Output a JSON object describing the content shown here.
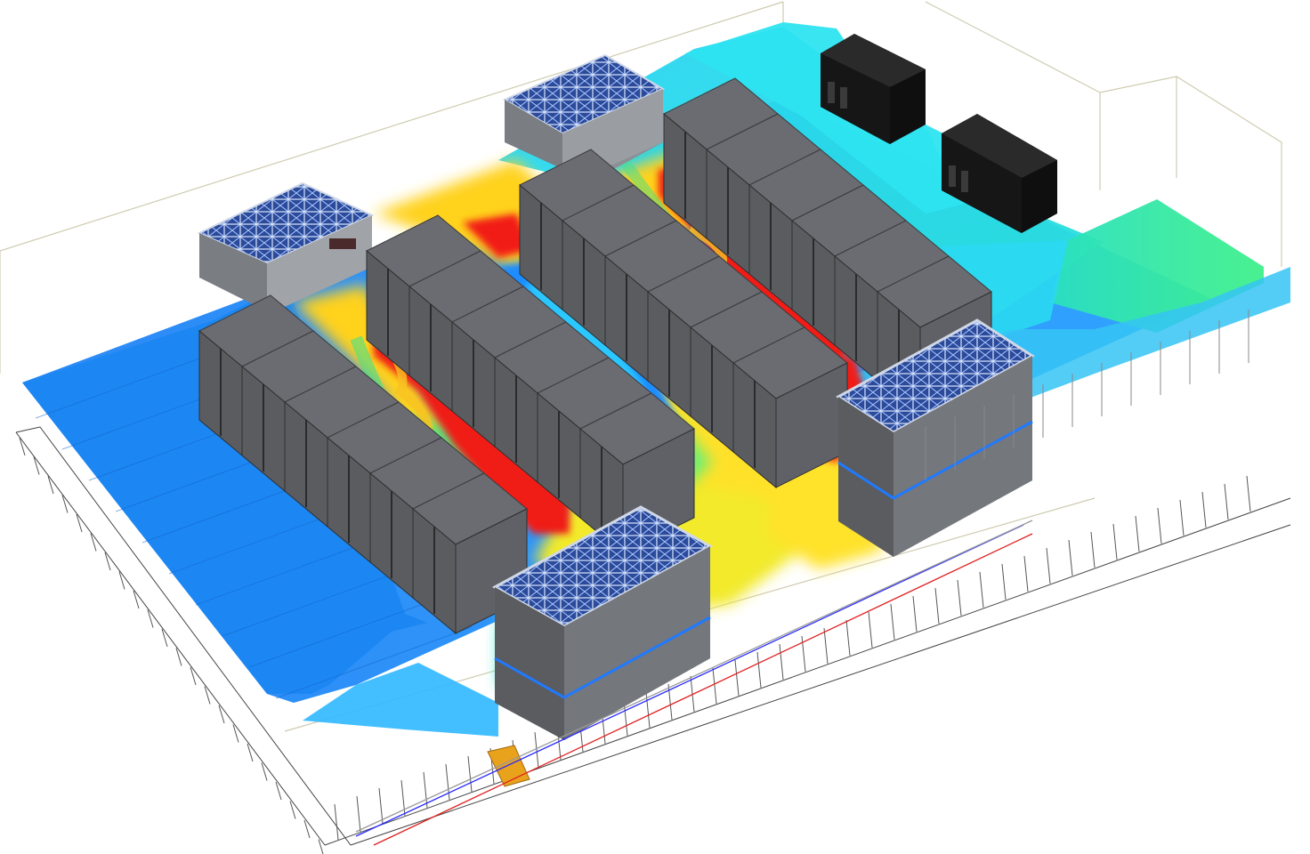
{
  "viewport": {
    "background": "#ffffff",
    "wire_color": "#c9c6a8",
    "floor_grid_color": "#3a3a3a"
  },
  "heatmap": {
    "scale": [
      "#1e88ff",
      "#22b8ff",
      "#23e0f0",
      "#3be8a8",
      "#8ef04a",
      "#e8f02a",
      "#ffc21a",
      "#ff7a1a",
      "#f02018"
    ],
    "cold_color": "#1e88ff",
    "cool_color": "#23d8f8",
    "hot_color": "#f02018",
    "warm_color": "#ffe21a"
  },
  "objects": {
    "rack_rows": [
      {
        "name": "rack-row-1",
        "racks": 6,
        "color": "#5f6166"
      },
      {
        "name": "rack-row-2",
        "racks": 6,
        "color": "#5f6166"
      },
      {
        "name": "rack-row-3",
        "racks": 6,
        "color": "#5f6166"
      },
      {
        "name": "rack-row-4",
        "racks": 6,
        "color": "#5f6166"
      }
    ],
    "cooling_units": [
      {
        "name": "crac-unit-north-west",
        "color": "#8c8f94"
      },
      {
        "name": "crac-unit-north",
        "color": "#8c8f94"
      },
      {
        "name": "crac-unit-east",
        "color": "#6a6c70"
      },
      {
        "name": "crac-unit-south",
        "color": "#6a6c70"
      }
    ],
    "cabinets": [
      {
        "name": "black-cabinet-1",
        "color": "#1c1c1c"
      },
      {
        "name": "black-cabinet-2",
        "color": "#1c1c1c"
      }
    ],
    "floor_tile_highlight": "#e8a21c"
  }
}
